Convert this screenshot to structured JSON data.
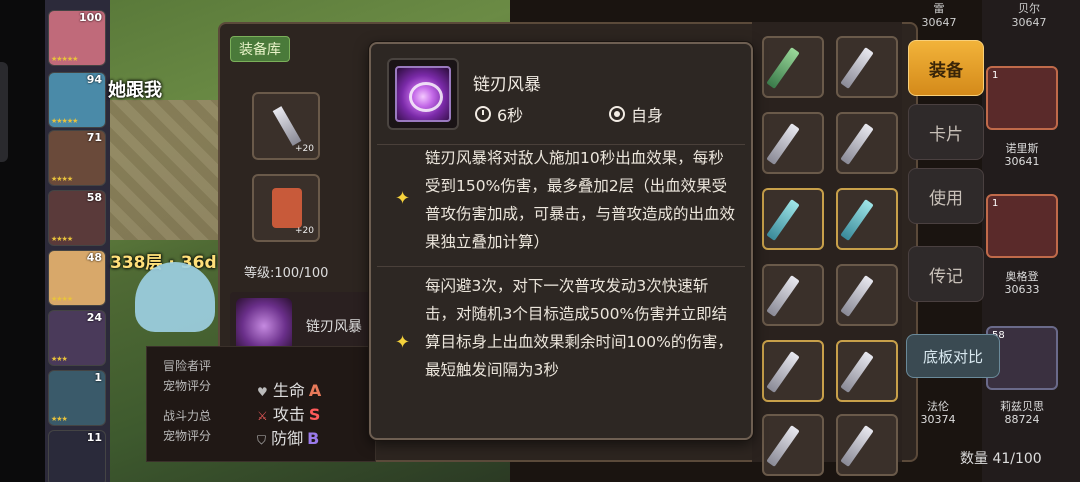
{
  "left_column": {
    "levels": [
      "100",
      "94",
      "71",
      "58",
      "48",
      "24",
      "1",
      "11"
    ]
  },
  "map": {
    "text_top": "她跟我",
    "floor_text": "338层 · 36d",
    "equip_tag": "装备库",
    "level_label": "等级:100/100",
    "slot_plus": "+20",
    "skill_name": "链刃风暴",
    "stats_left": [
      "冒险者评",
      "宠物评分",
      "战斗力总",
      "宠物评分"
    ],
    "stats": [
      {
        "label": "生命",
        "grade": "A"
      },
      {
        "label": "攻击",
        "grade": "S"
      },
      {
        "label": "防御",
        "grade": "B"
      }
    ]
  },
  "tooltip": {
    "title": "链刃风暴",
    "cooldown": "6秒",
    "target": "自身",
    "effects": [
      "链刃风暴将对敌人施加10秒出血效果，每秒受到150%伤害，最多叠加2层（出血效果受普攻伤害加成，可暴击，与普攻造成的出血效果独立叠加计算）",
      "每闪避3次，对下一次普攻发动3次快速斩击，对随机3个目标造成500%伤害并立即结算目标身上出血效果剩余时间100%的伤害，最短触发间隔为3秒"
    ]
  },
  "right_buttons": {
    "equip": "装备",
    "card": "卡片",
    "use": "使用",
    "legend": "传记",
    "compare": "底板对比"
  },
  "heroes": [
    {
      "name": "贝尔",
      "power": "30647"
    },
    {
      "name": "诺里斯",
      "power": "30641"
    },
    {
      "name": "奥格登",
      "power": "30633"
    },
    {
      "name": "莉兹贝思",
      "power": "88724"
    }
  ],
  "hero_levels": [
    "1",
    "1",
    "58"
  ],
  "side_names": [
    {
      "name": "雷",
      "power": "30647"
    },
    {
      "name": "法伦",
      "power": "30374"
    }
  ],
  "count": "数量 41/100",
  "colors": {
    "accent_gold": "#f2b33a",
    "tooltip_bg": "#2d2723",
    "star": "#f5d23c"
  }
}
